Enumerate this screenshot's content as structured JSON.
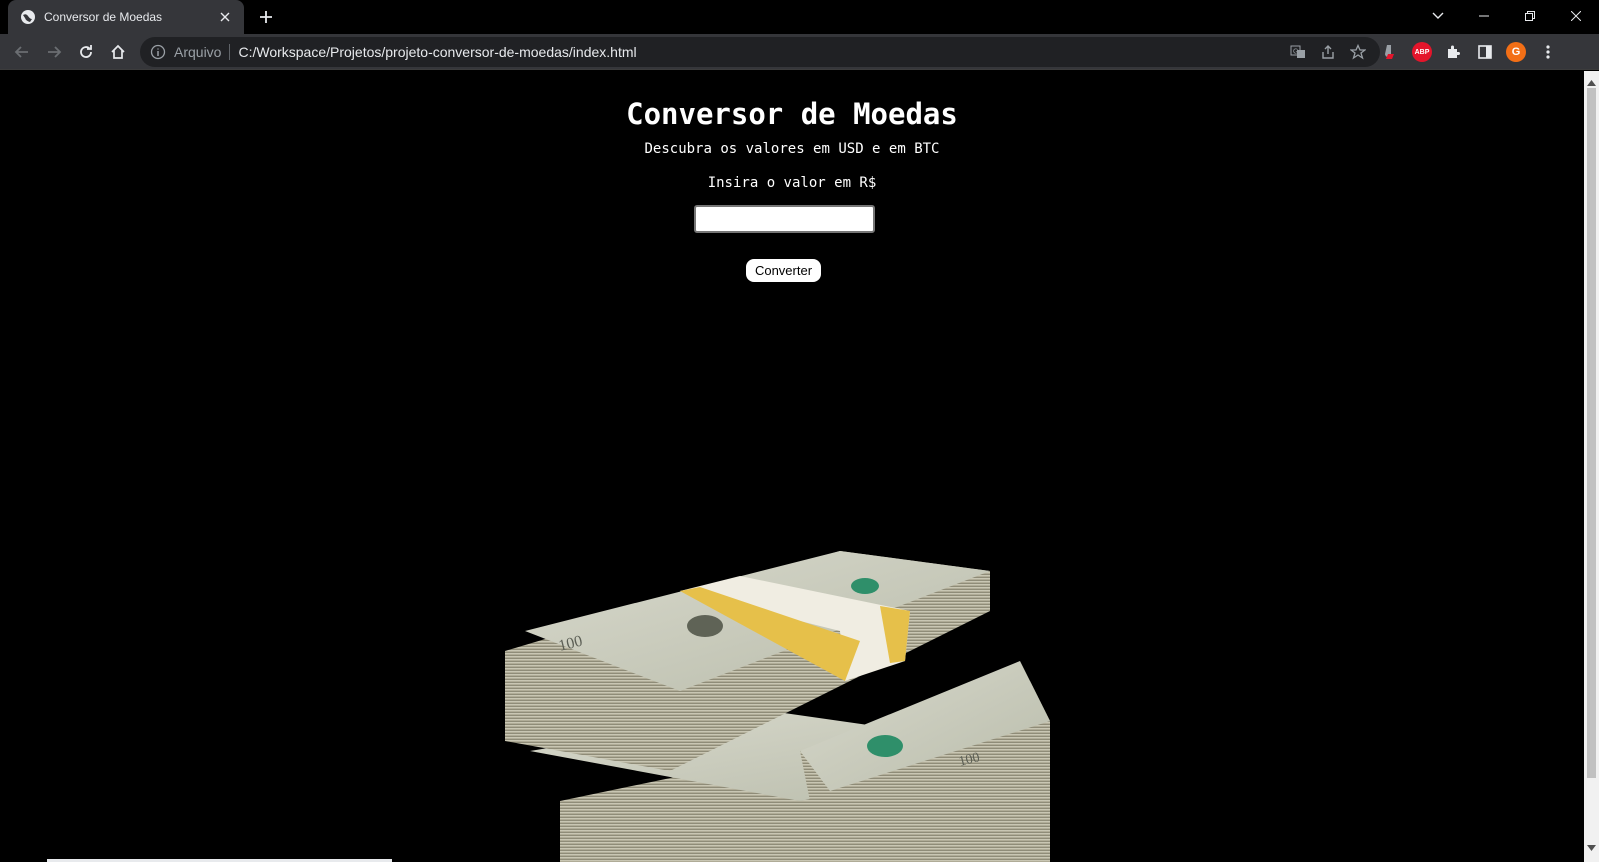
{
  "browser": {
    "tab": {
      "title": "Conversor de Moedas",
      "favicon": "globe-icon"
    },
    "omnibox": {
      "scheme_label": "Arquivo",
      "url": "C:/Workspace/Projetos/projeto-conversor-de-moedas/index.html"
    },
    "profile_initial": "G",
    "abp_label": "ABP",
    "icons": [
      "back-icon",
      "forward-icon",
      "reload-icon",
      "home-icon",
      "info-icon",
      "translate-icon",
      "share-icon",
      "star-icon",
      "extensions-icon",
      "side-panel-icon",
      "menu-icon",
      "minimize-icon",
      "restore-icon",
      "close-icon"
    ]
  },
  "page": {
    "title": "Conversor de Moedas",
    "subtitle": "Descubra os valores em USD e em BTC",
    "input_label": "Insira o valor em R$",
    "input_value": "",
    "convert_button": "Converter",
    "image": "stacks-of-100-dollar-bills"
  },
  "colors": {
    "background": "#000000",
    "text": "#ffffff",
    "tab_bg": "#35363a",
    "avatar": "#f36f16"
  }
}
